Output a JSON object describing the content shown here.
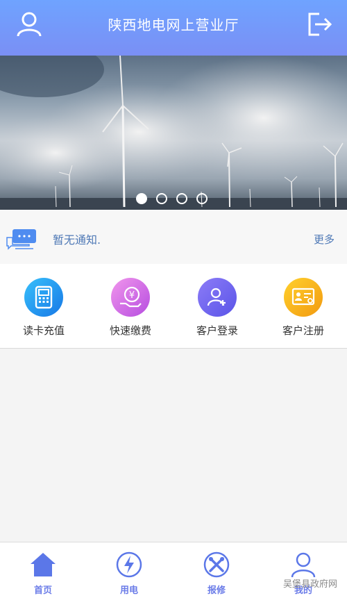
{
  "header": {
    "title": "陕西地电网上营业厅"
  },
  "banner": {
    "slides": 4,
    "active_index": 0
  },
  "notice": {
    "text": "暂无通知.",
    "more_label": "更多"
  },
  "menu": {
    "items": [
      {
        "label": "读卡充值",
        "icon": "card-reader-icon",
        "color": "#1e9bf0"
      },
      {
        "label": "快速缴费",
        "icon": "yuan-payment-icon",
        "color": "#d25fe0"
      },
      {
        "label": "客户登录",
        "icon": "user-add-icon",
        "color": "#6a67ef"
      },
      {
        "label": "客户注册",
        "icon": "id-card-icon",
        "color": "#f6b51c"
      }
    ]
  },
  "bottom_nav": {
    "items": [
      {
        "label": "首页",
        "icon": "home-icon"
      },
      {
        "label": "用电",
        "icon": "lightning-icon"
      },
      {
        "label": "报修",
        "icon": "repair-tools-icon"
      },
      {
        "label": "我的",
        "icon": "user-icon"
      }
    ]
  },
  "watermark": "吴堡县政府网"
}
